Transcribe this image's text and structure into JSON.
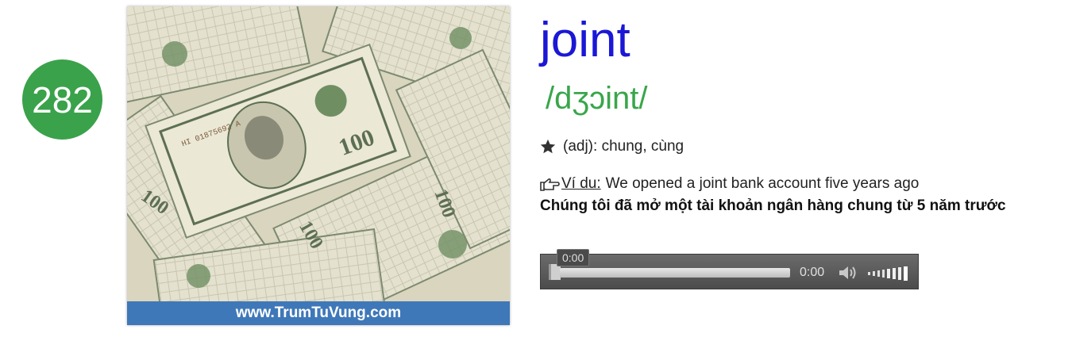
{
  "number": "282",
  "image": {
    "footer": "www.TrumTuVung.com"
  },
  "entry": {
    "word": "joint",
    "phonetic": "/dʒɔint/",
    "pos_icon": "star-icon",
    "pos_text": "(adj): chung, cùng",
    "example_icon": "pointing-hand-icon",
    "example_label": "Ví du:",
    "example_text": "We opened a joint bank account five years ago",
    "translation": "Chúng tôi đã mở một tài khoản ngân hàng chung từ 5 năm trước"
  },
  "player": {
    "tooltip": "0:00",
    "time": "0:00",
    "progress": 0,
    "volume_icon": "speaker-icon",
    "volume_level": 1
  },
  "colors": {
    "badge": "#3aa24a",
    "word": "#1b17d6",
    "phonetic": "#39a64a",
    "footer": "#3f78b8"
  }
}
